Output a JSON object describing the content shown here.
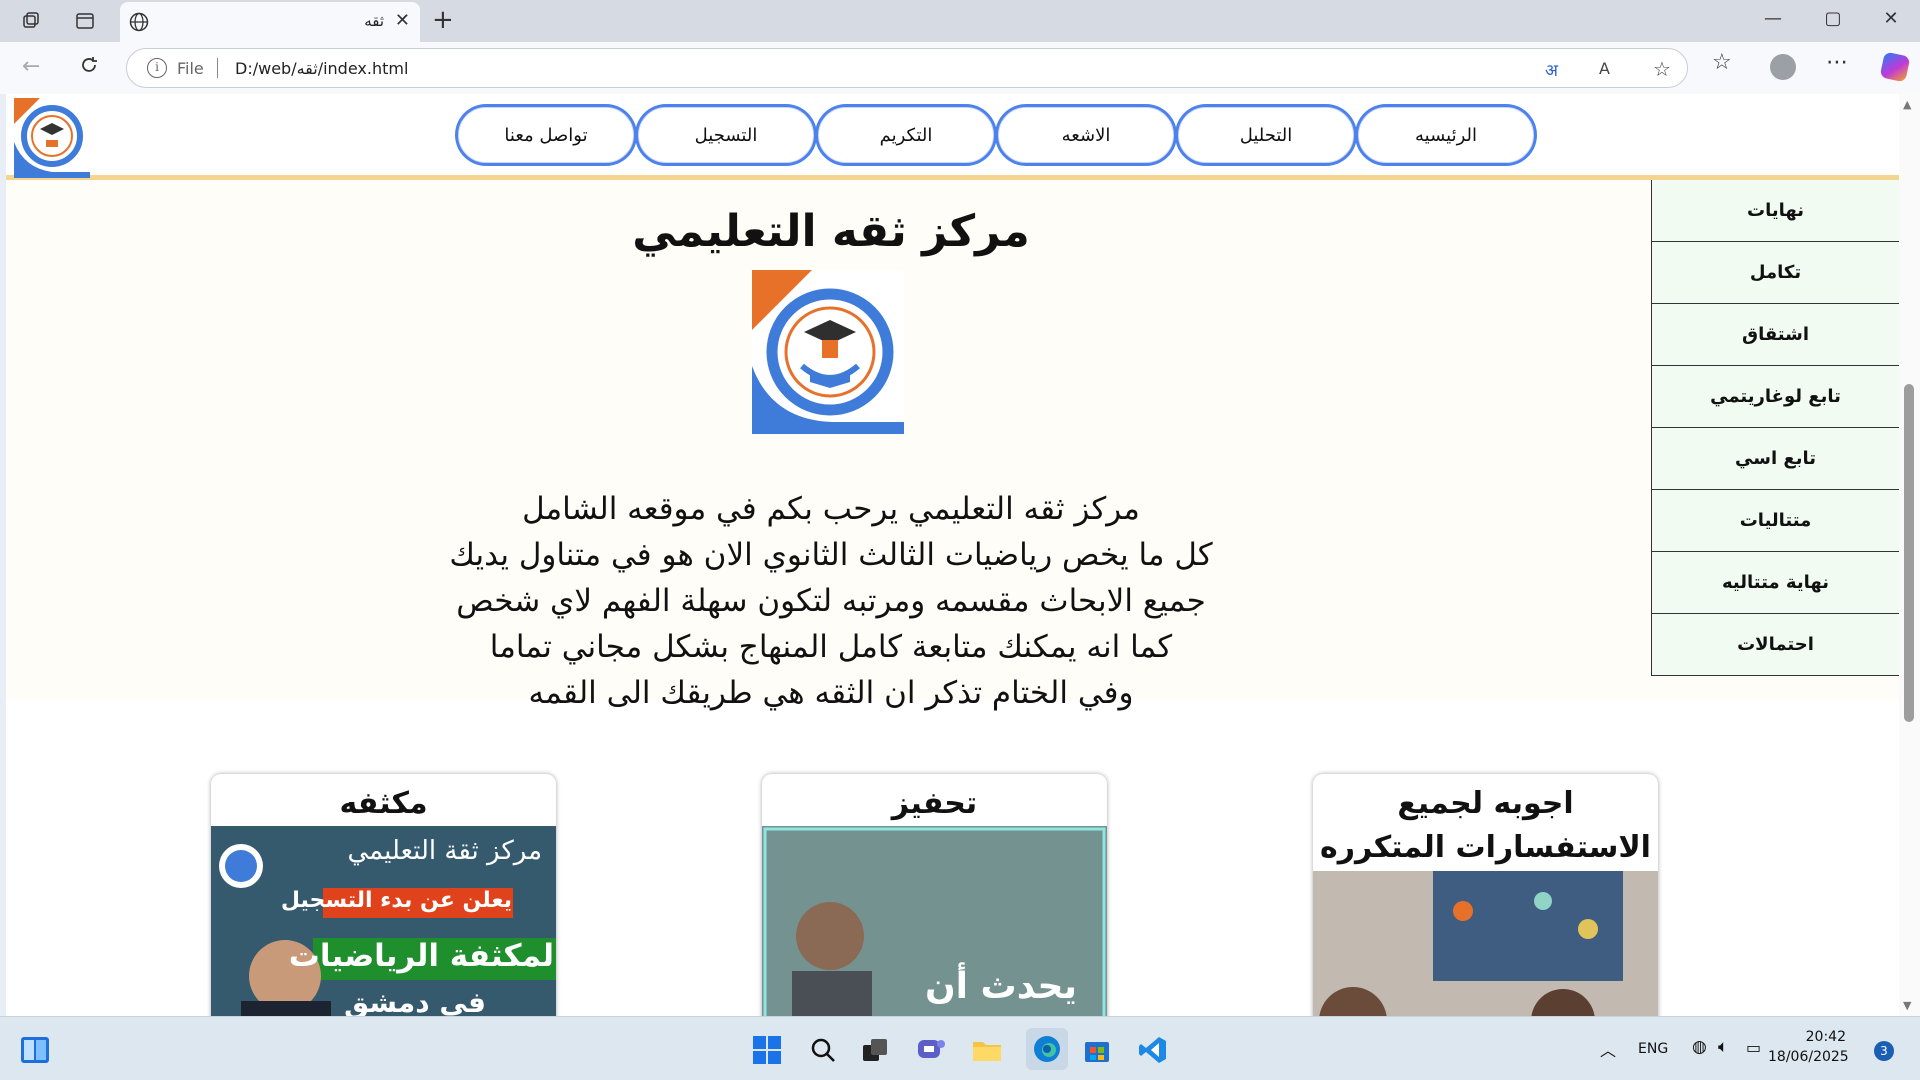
{
  "browser": {
    "tab_title": "ثقه",
    "tab_close": "✕",
    "new_tab": "+",
    "scheme_label": "File",
    "url": "D:/web/ثقه/index.html",
    "window_controls": {
      "minimize": "—",
      "maximize": "▢",
      "close": "✕"
    }
  },
  "nav": {
    "buttons": [
      "الرئيسيه",
      "التحليل",
      "الاشعه",
      "التكريم",
      "التسجيل",
      "تواصل معنا"
    ]
  },
  "main": {
    "title": "مركز ثقه التعليمي",
    "intro_lines": [
      "مركز ثقه التعليمي يرحب بكم في موقعه الشامل",
      "كل ما يخص رياضيات الثالث الثانوي الان هو في متناول يديك",
      "جميع الابحاث مقسمه ومرتبه لتكون سهلة الفهم لاي شخص",
      "كما انه يمكنك متابعة كامل المنهاج بشكل مجاني تماما",
      "وفي الختام تذكر ان الثقه هي طريقك الى القمه"
    ]
  },
  "sidebar": {
    "items": [
      "نهايات",
      "تكامل",
      "اشتقاق",
      "تابع لوغاريتمي",
      "تابع اسي",
      "متتاليات",
      "نهاية متتاليه",
      "احتمالات"
    ]
  },
  "cards": [
    {
      "title": "مكثفه",
      "image_text": [
        "مركز ثقة التعليمي",
        "يعلن عن بدء التسجيل",
        "لمكثفة الرياضيات",
        "في دمشق"
      ]
    },
    {
      "title": "تحفيز",
      "image_text": [
        "يحدث أن"
      ]
    },
    {
      "title": "اجوبه لجميع الاستفسارات المتكرره",
      "image_text": []
    }
  ],
  "taskbar": {
    "language": "ENG",
    "time": "20:42",
    "date": "18/06/2025",
    "notifications": "3"
  },
  "colors": {
    "nav_ring": "#4b82f0",
    "header_border": "#f4d590",
    "sidebar_bg": "#f1fbf2",
    "logo_blue": "#3f7bd8",
    "logo_orange": "#e8712a"
  }
}
